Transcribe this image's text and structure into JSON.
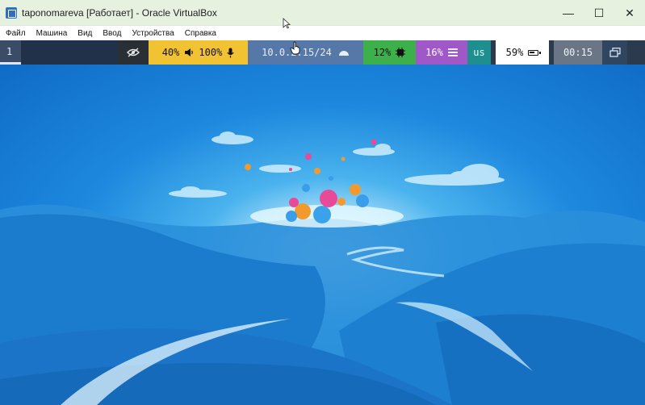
{
  "window": {
    "title": "taponomareva [Работает] - Oracle VirtualBox",
    "controls": {
      "minimize": "—",
      "maximize": "☐",
      "close": "✕"
    }
  },
  "menubar": {
    "items": [
      "Файл",
      "Машина",
      "Вид",
      "Ввод",
      "Устройства",
      "Справка"
    ]
  },
  "panel": {
    "workspace": "1",
    "volume_text": "40%",
    "mic_text": "100%",
    "network_text": "10.0.2.15/24",
    "cpu_text": "12%",
    "memory_text": "16%",
    "layout_text": "us",
    "battery_text": "59%",
    "clock_text": "00:15",
    "colors": {
      "volume": "#f1c232",
      "network": "#5578a8",
      "cpu": "#3db04b",
      "memory": "#a058c8",
      "layout": "#1e8e8e",
      "clock": "#6a7686"
    },
    "icons": [
      "eye-slash-icon",
      "speaker-icon",
      "microphone-icon",
      "wifi-icon",
      "cpu-chip-icon",
      "menu-lines-icon",
      "battery-icon",
      "window-switch-icon"
    ]
  }
}
